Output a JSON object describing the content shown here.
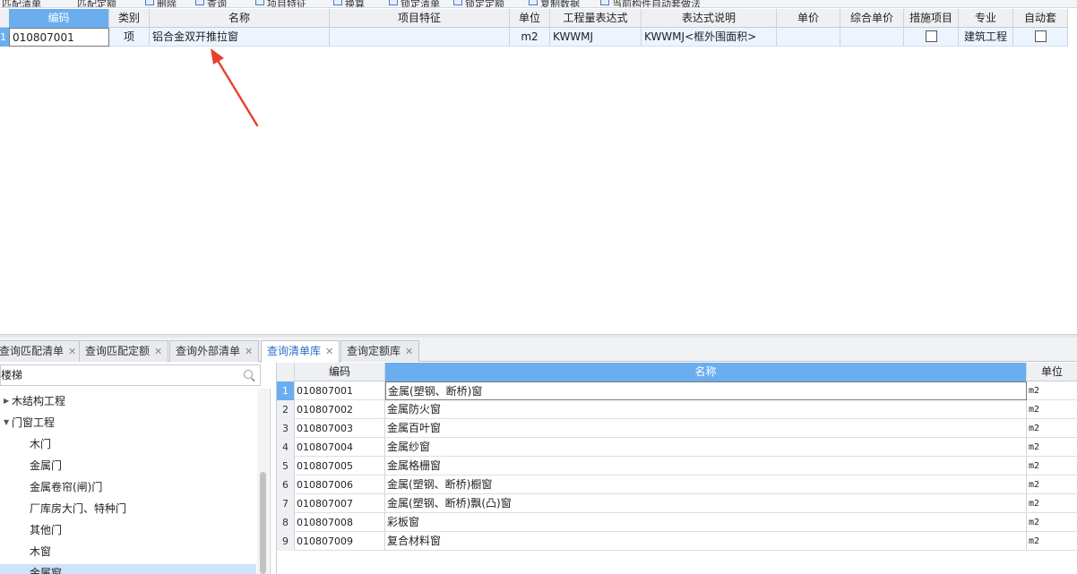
{
  "toolbar": {
    "items": [
      "匹配清单",
      "匹配定额",
      "删除",
      "查询",
      "项目特征",
      "换算",
      "锁定清单",
      "锁定定额",
      "复制数据",
      "当前构件自动套做法"
    ]
  },
  "top_grid": {
    "headers": {
      "code": "编码",
      "type": "类别",
      "name": "名称",
      "feature": "项目特征",
      "unit": "单位",
      "expr": "工程量表达式",
      "expr_desc": "表达式说明",
      "price": "单价",
      "total_price": "综合单价",
      "measure": "措施项目",
      "major": "专业",
      "auto": "自动套"
    },
    "row1": {
      "code": "010807001",
      "type": "项",
      "name": "铝合金双开推拉窗",
      "feature": "",
      "unit": "m2",
      "expr": "KWWMJ",
      "expr_desc": "KWWMJ<框外围面积>",
      "price": "",
      "total_price": "",
      "measure_checked": false,
      "major": "建筑工程",
      "auto_checked": false
    }
  },
  "bottom_tabs": [
    {
      "label": "查询匹配清单",
      "active": false
    },
    {
      "label": "查询匹配定额",
      "active": false
    },
    {
      "label": "查询外部清单",
      "active": false
    },
    {
      "label": "查询清单库",
      "active": true
    },
    {
      "label": "查询定额库",
      "active": false
    }
  ],
  "search": {
    "value": "楼梯"
  },
  "tree": {
    "items": [
      {
        "label": "木结构工程",
        "level": 0,
        "expanded": false
      },
      {
        "label": "门窗工程",
        "level": 0,
        "expanded": true
      },
      {
        "label": "木门",
        "level": 1
      },
      {
        "label": "金属门",
        "level": 1
      },
      {
        "label": "金属卷帘(闸)门",
        "level": 1
      },
      {
        "label": "厂库房大门、特种门",
        "level": 1
      },
      {
        "label": "其他门",
        "level": 1
      },
      {
        "label": "木窗",
        "level": 1
      },
      {
        "label": "金属窗",
        "level": 1,
        "selected": true
      }
    ]
  },
  "lib_grid": {
    "headers": {
      "code": "编码",
      "name": "名称",
      "unit": "单位"
    },
    "rows": [
      {
        "num": "1",
        "code": "010807001",
        "name": "金属(塑钢、断桥)窗",
        "unit": "m2"
      },
      {
        "num": "2",
        "code": "010807002",
        "name": "金属防火窗",
        "unit": "m2"
      },
      {
        "num": "3",
        "code": "010807003",
        "name": "金属百叶窗",
        "unit": "m2"
      },
      {
        "num": "4",
        "code": "010807004",
        "name": "金属纱窗",
        "unit": "m2"
      },
      {
        "num": "5",
        "code": "010807005",
        "name": "金属格栅窗",
        "unit": "m2"
      },
      {
        "num": "6",
        "code": "010807006",
        "name": "金属(塑钢、断桥)橱窗",
        "unit": "m2"
      },
      {
        "num": "7",
        "code": "010807007",
        "name": "金属(塑钢、断桥)飘(凸)窗",
        "unit": "m2"
      },
      {
        "num": "8",
        "code": "010807008",
        "name": "彩板窗",
        "unit": "m2"
      },
      {
        "num": "9",
        "code": "010807009",
        "name": "复合材料窗",
        "unit": "m2"
      }
    ]
  },
  "colors": {
    "accent": "#6aaef0",
    "row_highlight": "#ebf4ff",
    "tab_active_text": "#2a6fc9",
    "arrow": "#e8402b"
  }
}
